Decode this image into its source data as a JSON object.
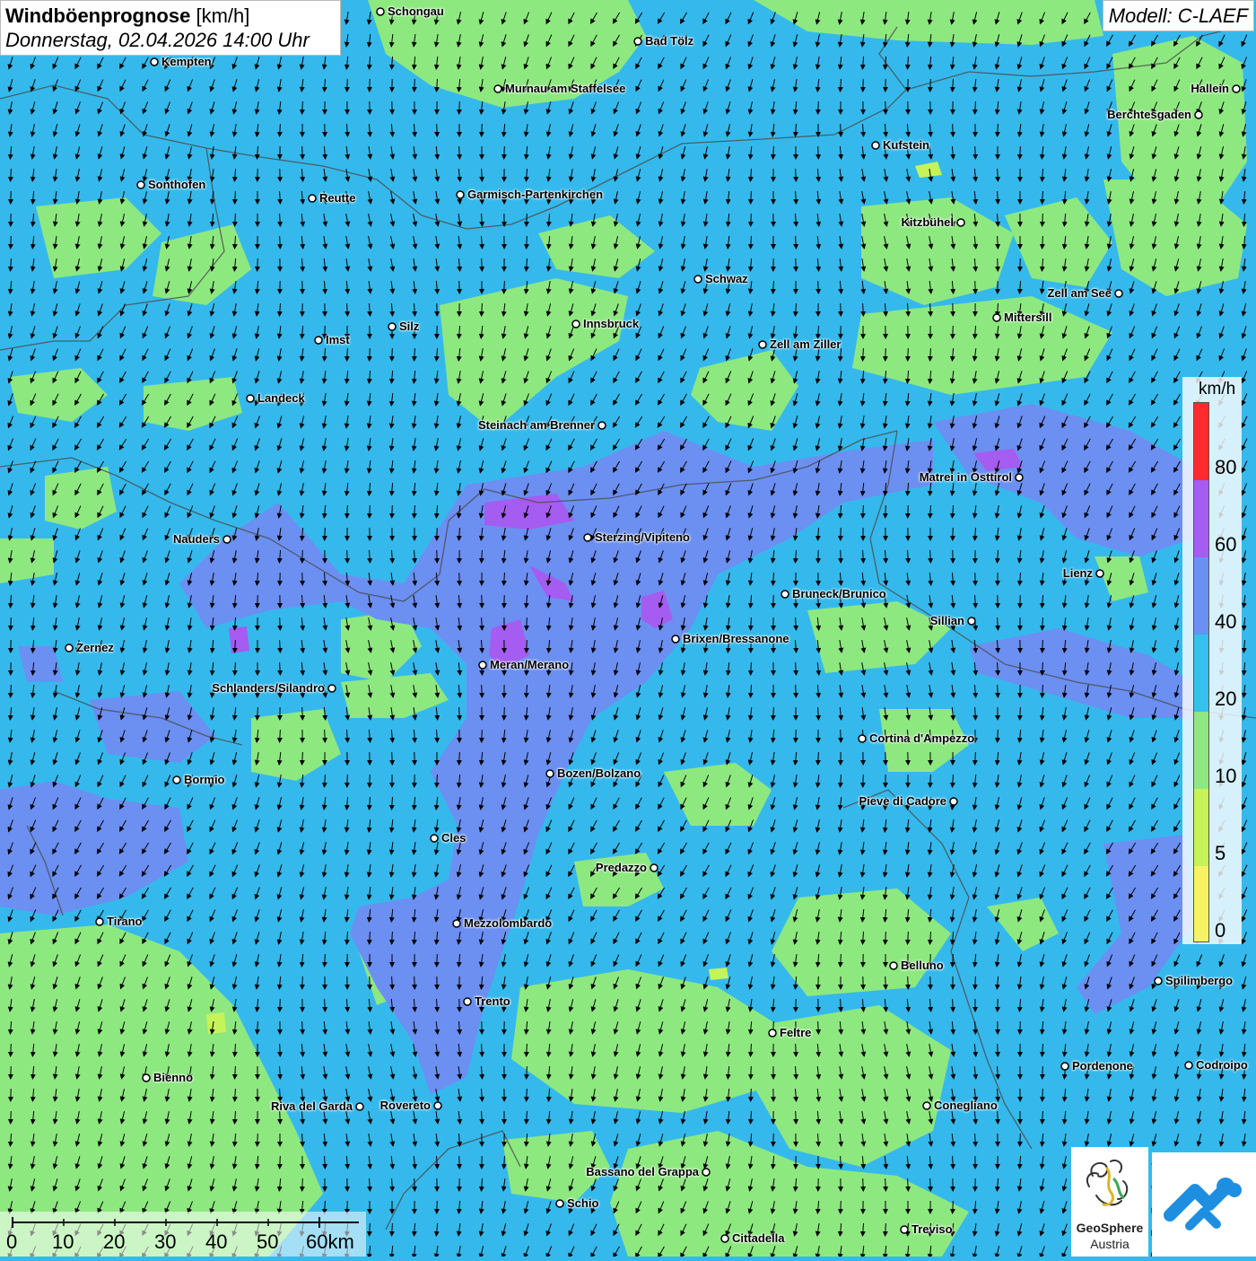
{
  "header": {
    "title": "Windböenprognose",
    "unit": "[km/h]",
    "date": "Donnerstag, 02.04.2026 14:00 Uhr"
  },
  "model": "Modell: C-LAEF",
  "legend": {
    "unit": "km/h",
    "ticks": [
      "80",
      "60",
      "40",
      "20",
      "10",
      "5",
      "0"
    ],
    "colors": [
      "#ff2a2a",
      "#a55cf0",
      "#6c8ff2",
      "#35c0ef",
      "#8ee880",
      "#c6f25a",
      "#f6f264"
    ]
  },
  "scale_bar": {
    "labels": [
      "0",
      "10",
      "20",
      "30",
      "40",
      "50",
      "60km"
    ]
  },
  "logo": {
    "name": "GeoSphere",
    "sub": "Austria"
  },
  "cities": [
    "Schongau",
    "Bad Tölz",
    "Kempten",
    "Murnau am Staffelsee",
    "Hallein",
    "Berchtesgaden",
    "Kufstein",
    "Sonthofen",
    "Reutte",
    "Garmisch-Partenkirchen",
    "Kitzbühel",
    "Schwaz",
    "Zell am See",
    "Innsbruck",
    "Mittersill",
    "Silz",
    "Imst",
    "Zell am Ziller",
    "Landeck",
    "Steinach am Brenner",
    "Matrei in Osttirol",
    "Nauders",
    "Sterzing/Vipiteno",
    "Lienz",
    "Bruneck/Brunico",
    "Sillian",
    "Brixen/Bressanone",
    "Zernez",
    "Meran/Merano",
    "Schlanders/Silandro",
    "Cortina d'Ampezzo",
    "Bozen/Bolzano",
    "Bormio",
    "Pieve di Cadore",
    "Cles",
    "Predazzo",
    "Tirano",
    "Mezzolombardo",
    "Belluno",
    "Spilimbergo",
    "Trento",
    "Feltre",
    "Pordenone",
    "Codroipo",
    "Bienno",
    "Riva del Garda",
    "Rovereto",
    "Conegliano",
    "Bassano del Grappa",
    "Schio",
    "Treviso",
    "Cittadella"
  ],
  "colors": {
    "calm_blue": "#35b9ec",
    "light_green": "#8ee880",
    "mid_blue": "#6c8ff2",
    "violet": "#a55cf0",
    "yellow_green": "#c6f25a"
  }
}
